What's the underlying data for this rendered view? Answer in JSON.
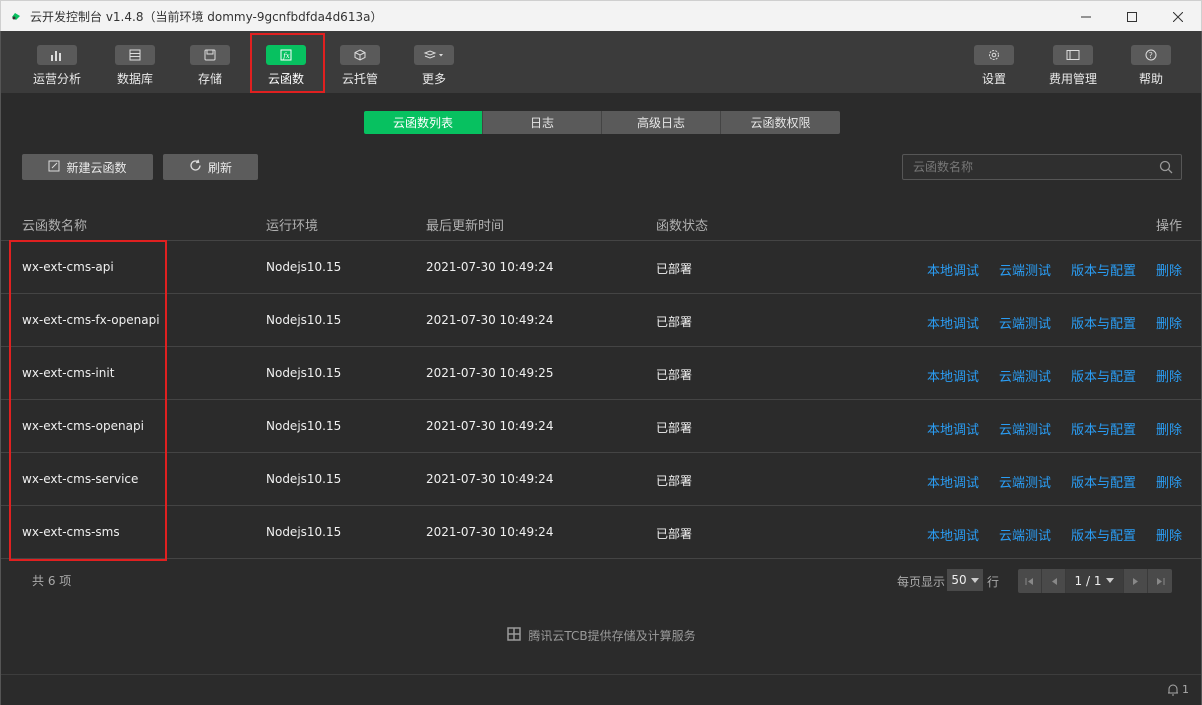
{
  "window": {
    "title": "云开发控制台 v1.4.8（当前环境 dommy-9gcnfbdfda4d613a）",
    "controls": [
      "minimize-icon",
      "maximize-icon",
      "close-icon"
    ]
  },
  "toolbar": {
    "left": [
      {
        "label": "运营分析",
        "icon": "bar-chart-icon"
      },
      {
        "label": "数据库",
        "icon": "database-icon"
      },
      {
        "label": "存储",
        "icon": "storage-icon"
      },
      {
        "label": "云函数",
        "icon": "function-icon",
        "active": true
      },
      {
        "label": "云托管",
        "icon": "cube-icon"
      },
      {
        "label": "更多",
        "icon": "layers-icon"
      }
    ],
    "right": [
      {
        "label": "设置",
        "icon": "gear-icon"
      },
      {
        "label": "费用管理",
        "icon": "billing-icon"
      },
      {
        "label": "帮助",
        "icon": "help-icon"
      }
    ]
  },
  "tabs": [
    "云函数列表",
    "日志",
    "高级日志",
    "云函数权限"
  ],
  "actions": {
    "new": "新建云函数",
    "refresh": "刷新"
  },
  "search": {
    "placeholder": "云函数名称"
  },
  "table": {
    "headers": {
      "name": "云函数名称",
      "runtime": "运行环境",
      "updated": "最后更新时间",
      "status": "函数状态",
      "ops": "操作"
    },
    "ops": [
      "本地调试",
      "云端测试",
      "版本与配置",
      "删除"
    ],
    "rows": [
      {
        "name": "wx-ext-cms-api",
        "runtime": "Nodejs10.15",
        "updated": "2021-07-30 10:49:24",
        "status": "已部署"
      },
      {
        "name": "wx-ext-cms-fx-openapi",
        "runtime": "Nodejs10.15",
        "updated": "2021-07-30 10:49:24",
        "status": "已部署"
      },
      {
        "name": "wx-ext-cms-init",
        "runtime": "Nodejs10.15",
        "updated": "2021-07-30 10:49:25",
        "status": "已部署"
      },
      {
        "name": "wx-ext-cms-openapi",
        "runtime": "Nodejs10.15",
        "updated": "2021-07-30 10:49:24",
        "status": "已部署"
      },
      {
        "name": "wx-ext-cms-service",
        "runtime": "Nodejs10.15",
        "updated": "2021-07-30 10:49:24",
        "status": "已部署"
      },
      {
        "name": "wx-ext-cms-sms",
        "runtime": "Nodejs10.15",
        "updated": "2021-07-30 10:49:24",
        "status": "已部署"
      }
    ]
  },
  "pagination": {
    "total": "共 6 项",
    "per_page_label": "每页显示",
    "per_page": "50",
    "per_page_unit": "行",
    "page": "1 / 1"
  },
  "footer": "腾讯云TCB提供存储及计算服务",
  "status": {
    "notifications": "1"
  },
  "colors": {
    "accent": "#07c160",
    "link": "#2a9df4",
    "highlight": "#e02020"
  }
}
